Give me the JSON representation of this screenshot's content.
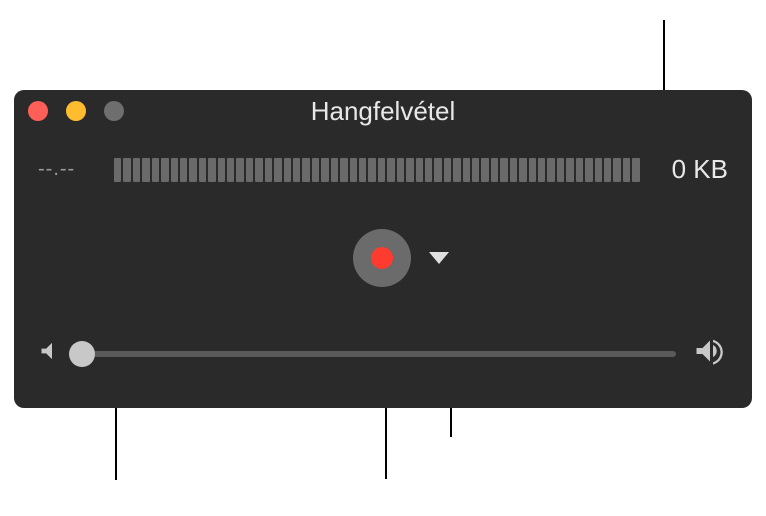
{
  "window": {
    "title": "Hangfelvétel"
  },
  "meter": {
    "time": "--.--",
    "file_size": "0 KB"
  },
  "volume": {
    "position_percent": 0
  }
}
